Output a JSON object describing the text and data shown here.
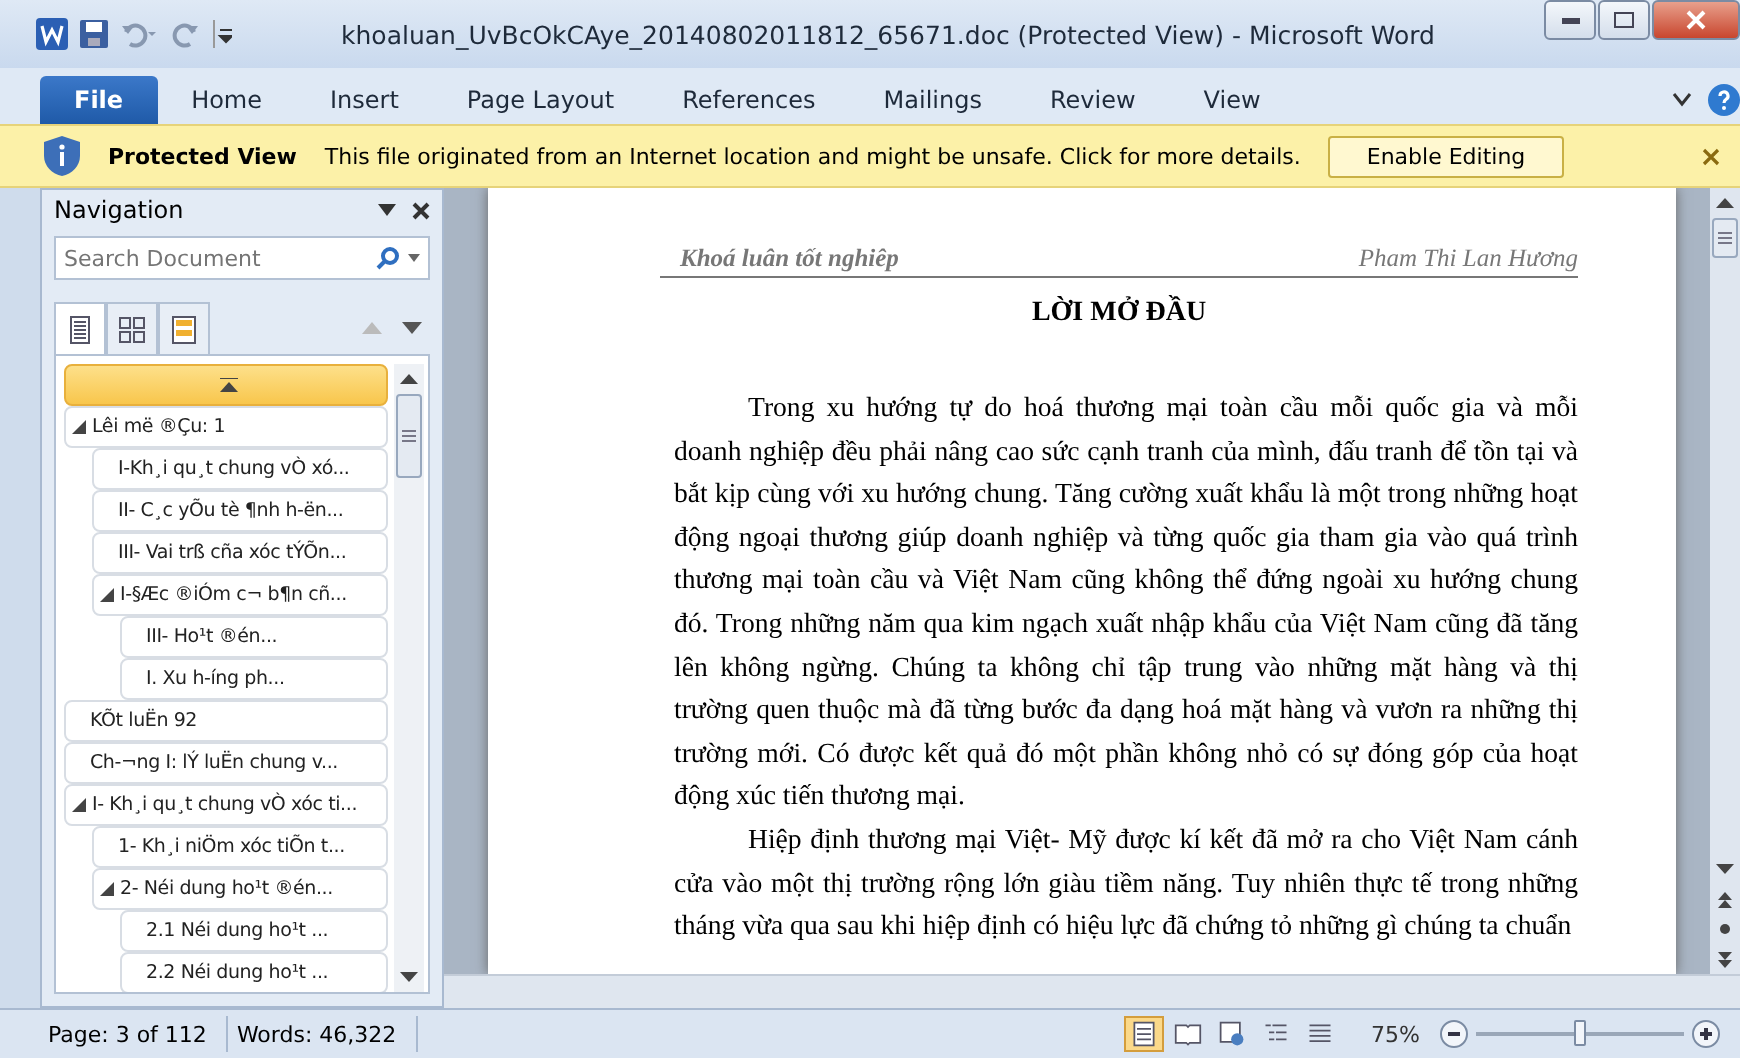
{
  "window": {
    "title": "khoaluan_UvBcOkCAye_20140802011812_65671.doc (Protected View) - Microsoft Word"
  },
  "ribbon_tabs": [
    {
      "label": "File",
      "selected": true
    },
    {
      "label": "Home",
      "selected": false
    },
    {
      "label": "Insert",
      "selected": false
    },
    {
      "label": "Page Layout",
      "selected": false
    },
    {
      "label": "References",
      "selected": false
    },
    {
      "label": "Mailings",
      "selected": false
    },
    {
      "label": "Review",
      "selected": false
    },
    {
      "label": "View",
      "selected": false
    }
  ],
  "message_bar": {
    "title": "Protected View",
    "message": "This file originated from an Internet location and might be unsafe. Click for more details.",
    "button": "Enable Editing"
  },
  "navigation": {
    "title": "Navigation",
    "search": {
      "placeholder": "Search Document"
    },
    "view_tabs": [
      {
        "kind": "headings",
        "selected": true
      },
      {
        "kind": "pages",
        "selected": false
      },
      {
        "kind": "results",
        "selected": false
      }
    ],
    "top_item": {
      "selected": true
    },
    "headings": [
      {
        "label": "Lêi më ®Çu: 1",
        "selected": false,
        "expanded": true,
        "children": [
          {
            "label": "I-Kh¸i qu¸t chung vÒ xó...",
            "selected": false
          },
          {
            "label": "II- C¸c yÕu tè ¶nh h-ën...",
            "selected": false
          },
          {
            "label": "III- Vai trß cña xóc tÝÕn...",
            "selected": false
          },
          {
            "label": "I-§Æc ®iÓm c¬ b¶n cñ...",
            "selected": false,
            "expanded": true,
            "children": [
              {
                "label": "III- Ho¹t ®én...",
                "selected": false
              },
              {
                "label": "I. Xu h-íng ph...",
                "selected": false
              }
            ]
          }
        ]
      },
      {
        "label": "KÕt luËn 92",
        "selected": false
      },
      {
        "label": "Ch-¬ng I: lÝ luËn chung v...",
        "selected": false
      },
      {
        "label": "I- Kh¸i qu¸t chung vÒ xóc ti...",
        "selected": false,
        "expanded": true,
        "children": [
          {
            "label": "1- Kh¸i niÖm xóc tiÕn t...",
            "selected": false
          },
          {
            "label": "2- Néi dung ho¹t ®én...",
            "selected": false,
            "expanded": true,
            "children": [
              {
                "label": "2.1 Néi dung ho¹t ...",
                "selected": false
              },
              {
                "label": "2.2 Néi dung ho¹t ...",
                "selected": false
              }
            ]
          }
        ]
      }
    ]
  },
  "document": {
    "header_left": "Khoá luân tốt nghiêp",
    "header_right": "Pham Thi Lan Hương",
    "heading": "LỜI MỞ ĐẦU",
    "paragraphs": [
      "Trong xu hướng tự do hoá thương mại toàn cầu mỗi quốc gia và mỗi doanh nghiệp đều phải nâng cao sức cạnh tranh của mình, đấu tranh để tồn tại và bắt kịp cùng với xu hướng chung. Tăng cường xuất khẩu là một trong những hoạt động ngoại thương giúp doanh nghiệp và từng quốc gia tham gia vào quá trình thương mại toàn cầu và Việt Nam cũng không thể đứng ngoài xu hướng chung đó. Trong những năm qua kim ngạch xuất nhập khẩu của Việt Nam cũng đã tăng lên không ngừng. Chúng ta không chỉ tập trung vào những mặt hàng và thị trường quen thuộc mà đã từng bước đa dạng hoá mặt hàng và vươn ra những thị trường mới. Có được kết quả đó một phần không nhỏ có sự đóng góp của hoạt động xúc tiến thương mại.",
      "Hiệp định thương mại Việt- Mỹ được kí kết đã mở ra cho Việt Nam cánh cửa vào một thị trường rộng lớn giàu tiềm năng. Tuy nhiên thực tế trong những tháng vừa qua sau khi hiệp định có hiệu lực đã chứng tỏ những gì chúng ta chuẩn"
    ]
  },
  "status_bar": {
    "page": "Page: 3 of 112",
    "words": "Words: 46,322",
    "views": [
      {
        "kind": "print",
        "selected": true
      },
      {
        "kind": "reading",
        "selected": false
      },
      {
        "kind": "web",
        "selected": false
      },
      {
        "kind": "outline",
        "selected": false
      },
      {
        "kind": "draft",
        "selected": false
      }
    ],
    "zoom": "75%",
    "zoom_slider": {
      "level": 0.5
    }
  }
}
